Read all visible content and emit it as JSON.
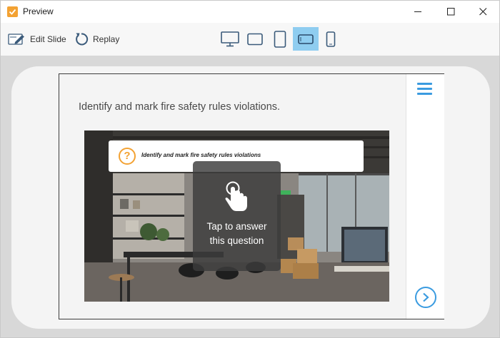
{
  "window": {
    "title": "Preview"
  },
  "toolbar": {
    "edit_label": "Edit Slide",
    "replay_label": "Replay",
    "devices": [
      "desktop-icon",
      "tablet-landscape-icon",
      "tablet-portrait-icon",
      "phone-landscape-icon",
      "phone-portrait-icon"
    ],
    "active_device": "phone-landscape-icon"
  },
  "slide": {
    "question": "Identify and mark fire safety rules violations.",
    "banner_icon": "?",
    "banner_text": "Identify and mark fire safety rules violations",
    "tap_line1": "Tap to answer",
    "tap_line2": "this question"
  },
  "colors": {
    "accent": "#3a9be0",
    "active_device_bg": "#8fcdf0",
    "orange": "#f3a233"
  }
}
